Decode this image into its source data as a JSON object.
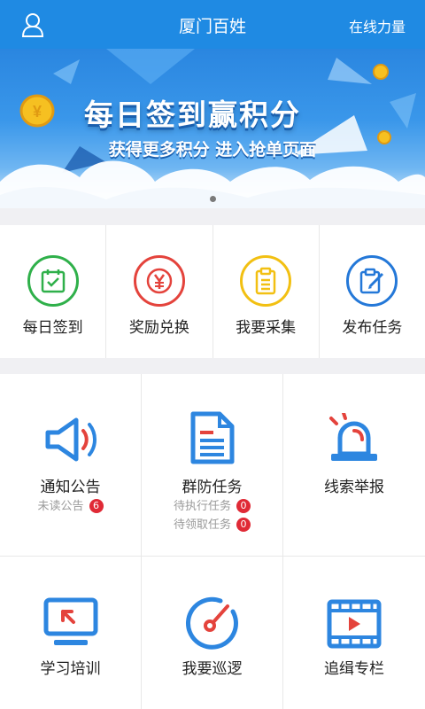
{
  "header": {
    "title": "厦门百姓",
    "right_action": "在线力量",
    "user_icon": "user-icon"
  },
  "banner": {
    "headline": "每日签到赢积分",
    "subline": "获得更多积分 进入抢单页面",
    "coin_glyph": "¥",
    "active_slide": 1,
    "slide_count": 1
  },
  "quick_actions": [
    {
      "label": "每日签到",
      "icon": "calendar-check-icon",
      "color": "#2fb04a"
    },
    {
      "label": "奖励兑换",
      "icon": "yen-icon",
      "color": "#e4433c"
    },
    {
      "label": "我要采集",
      "icon": "clipboard-icon",
      "color": "#f2c012"
    },
    {
      "label": "发布任务",
      "icon": "edit-icon",
      "color": "#2478d8"
    }
  ],
  "modules": [
    {
      "label": "通知公告",
      "icon": "speaker-icon",
      "sub1": "未读公告",
      "badge1": "6"
    },
    {
      "label": "群防任务",
      "icon": "document-icon",
      "sub1": "待执行任务",
      "badge1": "0",
      "sub2": "待领取任务",
      "badge2": "0"
    },
    {
      "label": "线索举报",
      "icon": "alarm-light-icon"
    },
    {
      "label": "学习培训",
      "icon": "monitor-icon"
    },
    {
      "label": "我要巡逻",
      "icon": "radar-icon"
    },
    {
      "label": "追缉专栏",
      "icon": "video-icon"
    }
  ],
  "colors": {
    "brand_blue": "#1f8ae3",
    "icon_blue": "#2d86e0",
    "icon_red": "#e4433c",
    "badge_red": "#e02a36"
  }
}
